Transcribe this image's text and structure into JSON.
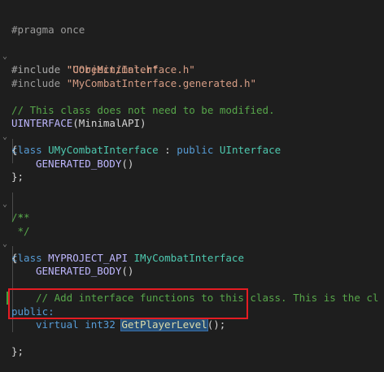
{
  "editor": {
    "lines": {
      "l1": {
        "t1": "#pragma once"
      },
      "l3": {
        "t1": "#include ",
        "t2": "\"CoreMinimal.h\""
      },
      "l4": {
        "t1": "#include ",
        "t2": "\"UObject/Interface.h\""
      },
      "l5": {
        "t1": "#include ",
        "t2": "\"MyCombatInterface.generated.h\""
      },
      "l7": {
        "t1": "// This class does not need to be modified."
      },
      "l8": {
        "t1": "UINTERFACE",
        "t2": "(MinimalAPI)"
      },
      "l9": {
        "t1": "class ",
        "t2": "UMyCombatInterface",
        "t3": " : ",
        "t4": "public ",
        "t5": "UInterface"
      },
      "l10": {
        "t1": "{"
      },
      "l11": {
        "t1": "GENERATED_BODY",
        "t2": "()"
      },
      "l12": {
        "t1": "};"
      },
      "l15": {
        "t1": "/**"
      },
      "l16": {
        "t1": " *"
      },
      "l17": {
        "t1": " */"
      },
      "l18": {
        "t1": "class ",
        "t2": "MYPROJECT_API ",
        "t3": "IMyCombatInterface"
      },
      "l19": {
        "t1": "{"
      },
      "l20": {
        "t1": "GENERATED_BODY",
        "t2": "()"
      },
      "l22": {
        "t1": "// Add interface functions to this class. This is the cl"
      },
      "l23": {
        "t1": "public:"
      },
      "l24": {
        "t1": "virtual ",
        "t2": "int32 ",
        "t3": "GetPlayerLevel",
        "t4": "()",
        "t5": ";"
      },
      "l26": {
        "t1": "};"
      }
    }
  },
  "colors": {
    "background": "#1e1e1e",
    "keyword": "#569cd6",
    "type": "#4ec9b0",
    "macro": "#beb7ff",
    "string": "#d69d85",
    "comment": "#57a64a",
    "annotation": "#e51c23"
  }
}
